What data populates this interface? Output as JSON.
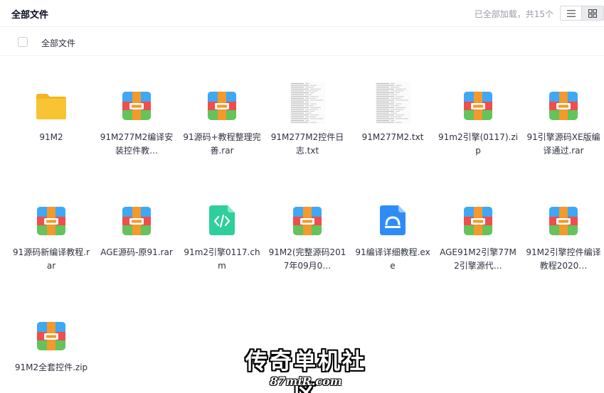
{
  "header": {
    "title": "全部文件",
    "load_status": "已全部加载，共15个",
    "view_list": "list-view-icon",
    "view_grid": "grid-view-icon"
  },
  "breadcrumb": {
    "label": "全部文件"
  },
  "files": [
    {
      "name": "91M2",
      "type": "folder"
    },
    {
      "name": "91M277M2编译安装控件教…",
      "type": "rar"
    },
    {
      "name": "91源码+教程整理完善.rar",
      "type": "rar"
    },
    {
      "name": "91M277M2控件日志.txt",
      "type": "txt"
    },
    {
      "name": "91M277M2.txt",
      "type": "txt"
    },
    {
      "name": "91m2引擎(0117).zip",
      "type": "rar"
    },
    {
      "name": "91引擎源码XE版编译通过.rar",
      "type": "rar"
    },
    {
      "name": "91源码新编译教程.rar",
      "type": "rar"
    },
    {
      "name": "AGE源码-原91.rar",
      "type": "rar"
    },
    {
      "name": "91m2引擎0117.chm",
      "type": "chm"
    },
    {
      "name": "91M2(完整源码2017年09月0…",
      "type": "rar"
    },
    {
      "name": "91编译详细教程.exe",
      "type": "exe"
    },
    {
      "name": "AGE91M2引擎77M2引擎源代…",
      "type": "rar"
    },
    {
      "name": "91M2引擎控件编译教程2020…",
      "type": "rar"
    },
    {
      "name": "91M2全套控件.zip",
      "type": "rar"
    }
  ],
  "watermark": {
    "title": "传奇单机社区",
    "url": "87miR.com"
  },
  "colors": {
    "folder": "#f7c434",
    "archive_top": "#3ea8f4",
    "archive_left": "#f04d4d",
    "archive_band": "#f29a2c",
    "archive_bottom": "#64c35a",
    "chm": "#2ecf9a",
    "exe": "#2f8cf6"
  }
}
